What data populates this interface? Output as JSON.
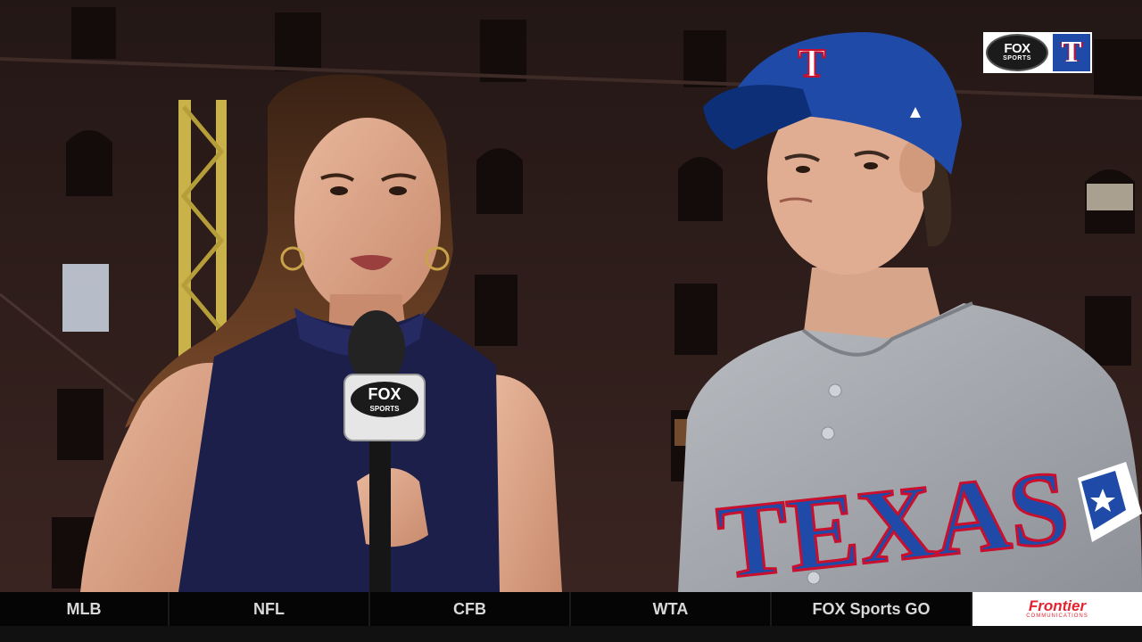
{
  "broadcast_bug": {
    "network_line1": "FOX",
    "network_line2": "SPORTS",
    "team_letter": "T"
  },
  "microphone_flag": {
    "line1": "FOX",
    "line2": "SPORTS"
  },
  "jersey": {
    "lettering": "TEXAS"
  },
  "nav": {
    "items": [
      {
        "label": "MLB"
      },
      {
        "label": "NFL"
      },
      {
        "label": "CFB"
      },
      {
        "label": "WTA"
      },
      {
        "label": "FOX Sports GO"
      }
    ],
    "sponsor": {
      "name": "Frontier",
      "subtitle": "COMMUNICATIONS"
    }
  },
  "colors": {
    "brick_dark": "#2a1a18",
    "jersey_gray": "#a9adb3",
    "rangers_blue": "#1f4aa8",
    "rangers_red": "#c8102e",
    "reporter_dress": "#1c1f4a",
    "sponsor_red": "#e5232f"
  }
}
